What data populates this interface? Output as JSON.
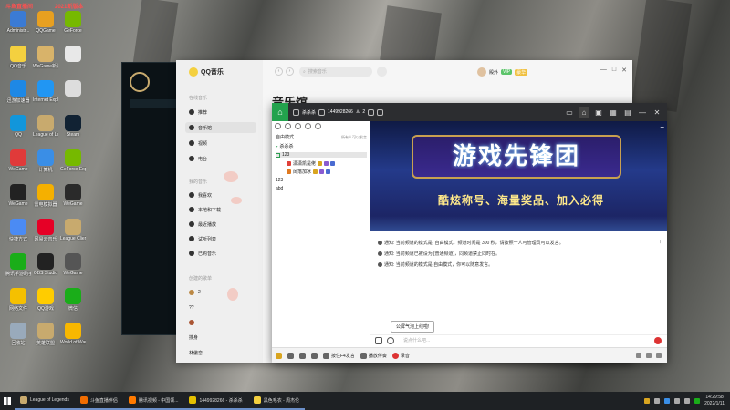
{
  "desktop": {
    "top_tags": [
      "斗鱼直播间",
      "2021新版本"
    ],
    "icons": [
      {
        "label": "Administr...",
        "color": "#3b7bd4"
      },
      {
        "label": "QQGame",
        "color": "#e8a020"
      },
      {
        "label": "GeForce",
        "color": "#76b900"
      },
      {
        "label": "QQ音乐",
        "color": "#f4d03f"
      },
      {
        "label": "WeGame新版",
        "color": "#d8b36a"
      },
      {
        "label": "",
        "color": "#e8e8e8"
      },
      {
        "label": "迅游加速器",
        "color": "#1e88e5"
      },
      {
        "label": "Internet Explorer",
        "color": "#2196f3"
      },
      {
        "label": "",
        "color": "#ddd"
      },
      {
        "label": "QQ",
        "color": "#1296db"
      },
      {
        "label": "League of Legends",
        "color": "#c8aa6e"
      },
      {
        "label": "Steam",
        "color": "#123"
      },
      {
        "label": "WeGame",
        "color": "#e03a3a"
      },
      {
        "label": "计算机",
        "color": "#3a8ee6"
      },
      {
        "label": "GeForce Experience",
        "color": "#76b900"
      },
      {
        "label": "WeGame",
        "color": "#222"
      },
      {
        "label": "雷电模拟器",
        "color": "#f5b000"
      },
      {
        "label": "WeGame",
        "color": "#2a2a2a"
      },
      {
        "label": "快捷方式",
        "color": "#4b8bf4"
      },
      {
        "label": "网易云音乐",
        "color": "#e60026"
      },
      {
        "label": "League Clien",
        "color": "#c8aa6e"
      },
      {
        "label": "腾讯手游助手",
        "color": "#1aad19"
      },
      {
        "label": "OBS Studio",
        "color": "#222"
      },
      {
        "label": "WeGame",
        "color": "#555"
      },
      {
        "label": "网络文件",
        "color": "#f5c000"
      },
      {
        "label": "QQ游戏",
        "color": "#ffcc00"
      },
      {
        "label": "微信",
        "color": "#1aad19"
      },
      {
        "label": "回收站",
        "color": "#9ab"
      },
      {
        "label": "英雄联盟",
        "color": "#c8aa6e"
      },
      {
        "label": "World of Warcraft",
        "color": "#f8b700"
      }
    ]
  },
  "qqmusic": {
    "brand": "QQ音乐",
    "search_placeholder": "搜索音乐",
    "page_title": "音乐馆",
    "user_name": "殿外",
    "vip1": "VIP",
    "vip2": "豪华",
    "sections": {
      "online": "在线音乐",
      "mine": "我的音乐",
      "created": "创建的歌单"
    },
    "online_items": [
      "推荐",
      "音乐馆",
      "视频",
      "电台"
    ],
    "mine_items": [
      "我喜欢",
      "本地和下载",
      "最近播放",
      "试听列表",
      "已购音乐"
    ],
    "created_items": [
      "2",
      "??",
      "",
      "搜身",
      "林傲恋"
    ],
    "win_controls": [
      "—",
      "□",
      "✕"
    ]
  },
  "room": {
    "room_name": "杀杀杀",
    "room_id": "1449928266",
    "member_count": "2",
    "mode": "自由模式",
    "mode_hint": "所有人可以发言",
    "channels": [
      {
        "name": "杀杀杀",
        "right": "",
        "kind": "head"
      },
      {
        "name": "123",
        "right": "",
        "kind": "sel"
      },
      {
        "name": "潇潇凯是佬",
        "right": "",
        "kind": "user",
        "color": "#e0403a"
      },
      {
        "name": "阔落加冰",
        "right": "",
        "kind": "user",
        "color": "#e07a20"
      },
      {
        "name": "123",
        "right": "",
        "kind": "plain"
      },
      {
        "name": "abd",
        "right": "",
        "kind": "plain"
      }
    ],
    "banner_title": "游戏先锋团",
    "banner_slogan": "酷炫称号、海量奖品、加入必得",
    "messages": [
      "通知: 当前频道的模式是: 自由模式，频道时间是 300 秒，请按照一人可管理员可以发言。",
      "通知: 当前频道已被设为 [普通频道]，同频道禁止同时在。",
      "通知: 当前频道的模式是 自由模式，你可以随意发言。"
    ],
    "tooltip": "公屏气泡上线啦!",
    "input_placeholder": "说点什么吧...",
    "bottom_items": [
      "",
      "",
      "",
      "",
      "按住F4发言",
      "",
      "播放伴奏",
      "",
      "录音"
    ],
    "colors": {
      "home": "#23a24d",
      "topbar": "#2c2d30"
    }
  },
  "taskbar": {
    "tasks": [
      {
        "label": "League of Legends",
        "color": "#c8aa6e"
      },
      {
        "label": "斗鱼直播伴侣",
        "color": "#f06c00"
      },
      {
        "label": "腾讯视频 - 中国领...",
        "color": "#ff7a00"
      },
      {
        "label": "1449928266 - 杀杀杀",
        "color": "#e5c000"
      },
      {
        "label": "黑色毛衣 - 周杰伦",
        "color": "#f4d03f"
      }
    ],
    "time": "14:29:58",
    "date": "2022/1/11"
  }
}
